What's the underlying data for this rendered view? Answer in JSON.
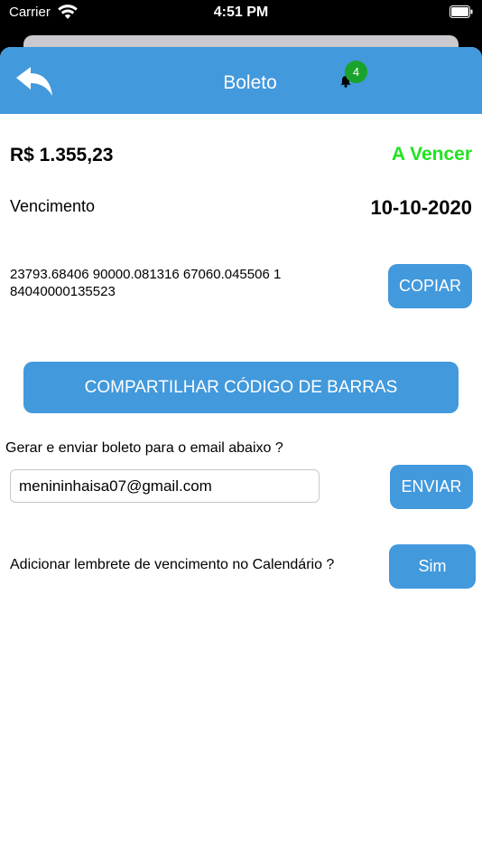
{
  "status_bar": {
    "carrier": "Carrier",
    "time": "4:51 PM"
  },
  "header": {
    "title": "Boleto",
    "notification_count": "4"
  },
  "summary": {
    "amount": "R$ 1.355,23",
    "status": "A Vencer",
    "status_color": "#1ee51e",
    "due_label": "Vencimento",
    "due_date": "10-10-2020"
  },
  "barcode": {
    "code": "23793.68406 90000.081316 67060.045506 1\n84040000135523",
    "copy_label": "COPIAR"
  },
  "share": {
    "label": "COMPARTILHAR CÓDIGO DE BARRAS"
  },
  "email": {
    "prompt": "Gerar e enviar boleto para o email abaixo ?",
    "value": "menininhaisa07@gmail.com",
    "send_label": "ENVIAR"
  },
  "calendar": {
    "prompt": "Adicionar lembrete de vencimento no Calendário ?",
    "yes_label": "Sim"
  },
  "colors": {
    "accent": "#4299dc",
    "badge": "#1aa32b"
  }
}
